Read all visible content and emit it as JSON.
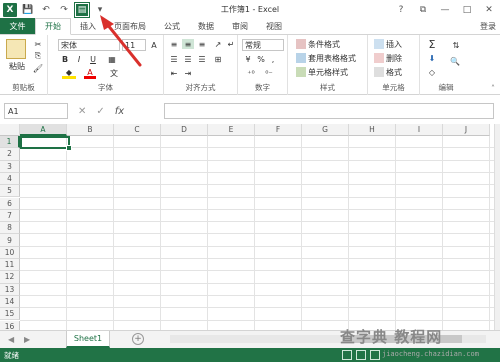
{
  "window": {
    "title": "工作簿1 - Excel"
  },
  "qat": {
    "logo": "X",
    "save": "💾",
    "undo": "↶",
    "redo": "↷",
    "custom": "▤",
    "more": "▾"
  },
  "wincontrols": {
    "help": "?",
    "restore": "⧉",
    "minimize": "—",
    "maximize": "□",
    "close": "✕"
  },
  "tabs": {
    "file": "文件",
    "home": "开始",
    "insert": "插入",
    "page_layout": "页面布局",
    "formulas": "公式",
    "data": "数据",
    "review": "审阅",
    "view": "视图",
    "login": "登录"
  },
  "ribbon": {
    "clipboard": {
      "label": "剪贴板",
      "paste": "粘贴"
    },
    "font": {
      "label": "字体",
      "name": "宋体",
      "size": "11",
      "bold": "B",
      "italic": "I",
      "underline": "U",
      "font_color": "A"
    },
    "alignment": {
      "label": "对齐方式"
    },
    "number": {
      "label": "数字",
      "format": "常规",
      "percent": "%",
      "comma": ","
    },
    "styles": {
      "label": "样式",
      "conditional": "条件格式",
      "table": "套用表格格式",
      "cell_styles": "单元格样式"
    },
    "cells": {
      "label": "单元格",
      "insert": "插入",
      "delete": "删除",
      "format": "格式"
    },
    "editing": {
      "label": "编辑",
      "sum": "Σ"
    }
  },
  "formulabar": {
    "namebox": "A1",
    "cancel": "✕",
    "enter": "✓",
    "fx": "fx"
  },
  "columns": [
    "A",
    "B",
    "C",
    "D",
    "E",
    "F",
    "G",
    "H",
    "I",
    "J"
  ],
  "rows": [
    "1",
    "2",
    "3",
    "4",
    "5",
    "6",
    "7",
    "8",
    "9",
    "10",
    "11",
    "12",
    "13",
    "14",
    "15",
    "16"
  ],
  "sheets": {
    "active": "Sheet1",
    "add": "+"
  },
  "status": {
    "text": "就绪"
  },
  "watermark": {
    "line1": "查字典 教程网",
    "line2": "jiaocheng.chazidian.com"
  },
  "colors": {
    "accent": "#1e7145",
    "status": "#217346",
    "arrow": "#d9302c"
  }
}
